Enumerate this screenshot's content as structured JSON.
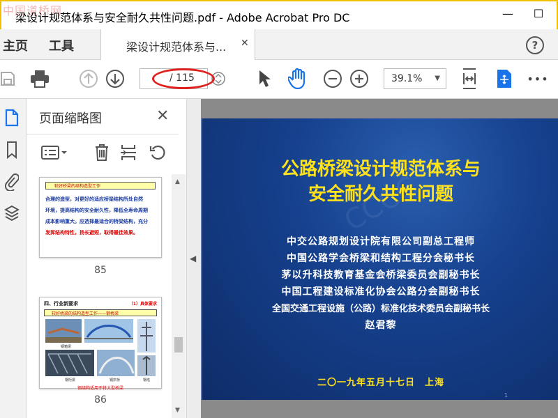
{
  "window": {
    "title": "梁设计规范体系与安全耐久共性问题.pdf - Adobe Acrobat Pro DC",
    "watermark": "中国道桥网",
    "minimize_glyph": "—",
    "maximize_glyph": "☐"
  },
  "menu": {
    "home": "主页",
    "tools": "工具",
    "tab_label": "梁设计规范体系与...",
    "tab_close": "✕",
    "help": "?"
  },
  "toolbar": {
    "page_current": "",
    "page_total": "/ 115",
    "zoom": "39.1%",
    "more": "•••"
  },
  "panel": {
    "title": "页面缩略图",
    "close": "✕"
  },
  "thumbnails": [
    {
      "page": "85",
      "header": "较好桥梁的结构造型工作",
      "lines": [
        "合理的造型，对更好的适应桥梁结构所处自然",
        "环境，提高结构的安全耐久性，降低全寿命周期",
        "成本影响重大。应选择最适合的桥梁结构，充分"
      ],
      "highlight": "发挥结构特性，扬长避短，取得最佳效果。"
    },
    {
      "page": "86",
      "section": "四、行业新要求",
      "tag": "（1）具体要求",
      "header": "较好桥梁的结构造型工作——钢桥梁",
      "captions": [
        "钢箱梁",
        "钢桁梁",
        "钢拱桥",
        "钢塔"
      ],
      "footer": "钢结构适用于特大型桥梁"
    }
  ],
  "slide": {
    "title_line1": "公路桥梁设计规范体系与",
    "title_line2": "安全耐久共性问题",
    "lines": [
      "中交公路规划设计院有限公司副总工程师",
      "中国公路学会桥梁和结构工程分会秘书长",
      "茅以升科技教育基金会桥梁委员会副秘书长",
      "中国工程建设标准化协会公路分会副秘书长",
      "全国交通工程设施（公路）标准化技术委员会副秘书长"
    ],
    "author": "赵君黎",
    "date": "二〇一九年五月十七日　上海",
    "page_no": "1"
  },
  "colors": {
    "accent_blue": "#1a73e8",
    "slide_bg": "#12347a",
    "title_yellow": "#ffe21a",
    "annotation_red": "#e0201c"
  }
}
